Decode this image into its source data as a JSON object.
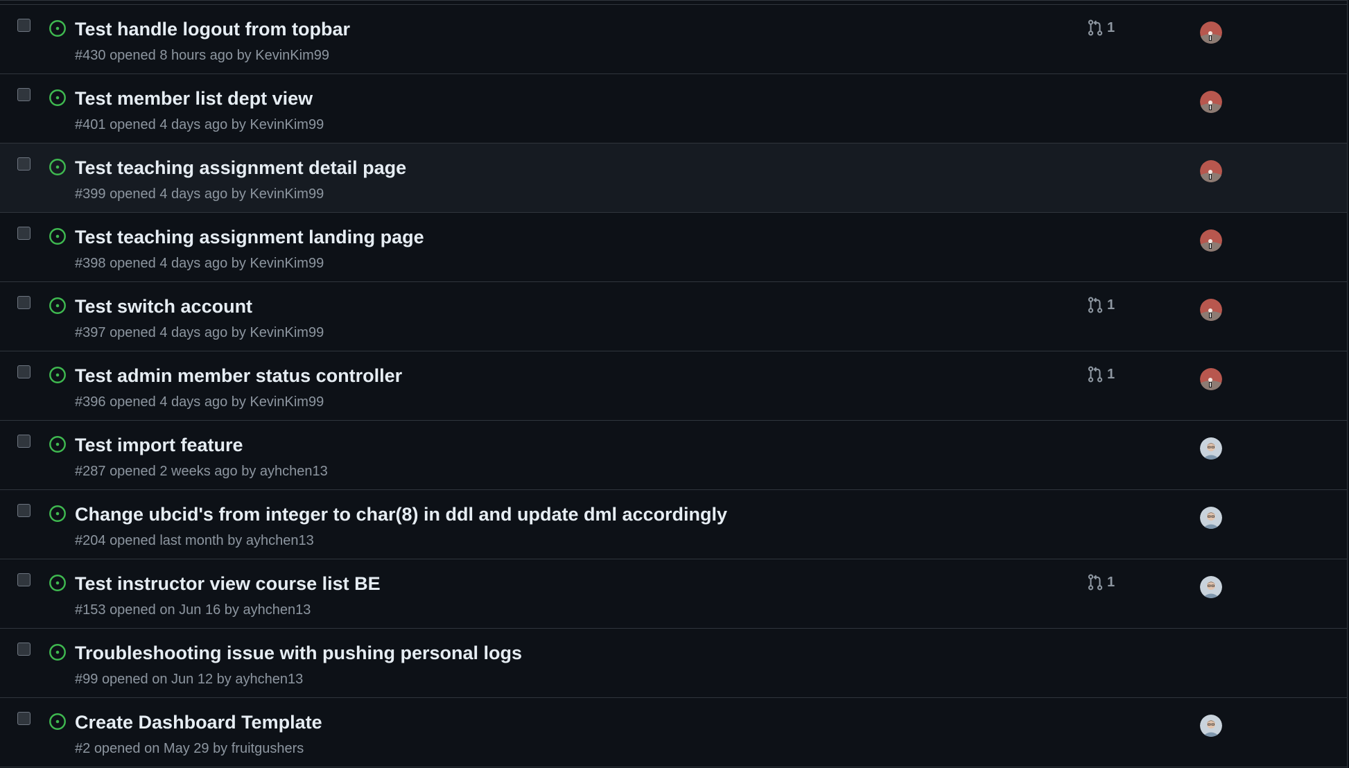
{
  "colors": {
    "background": "#0d1117",
    "row_hover": "#161b22",
    "border": "#30363d",
    "open_icon": "#3fb950",
    "title_text": "#e6edf3",
    "meta_text": "#8d96a0"
  },
  "issues": [
    {
      "title": "Test handle logout from topbar",
      "number": "#430",
      "opened": "opened 8 hours ago",
      "by": "by",
      "author": "KevinKim99",
      "pr_count": "1",
      "avatar": "kevin"
    },
    {
      "title": "Test member list dept view",
      "number": "#401",
      "opened": "opened 4 days ago",
      "by": "by",
      "author": "KevinKim99",
      "pr_count": null,
      "avatar": "kevin"
    },
    {
      "title": "Test teaching assignment detail page",
      "number": "#399",
      "opened": "opened 4 days ago",
      "by": "by",
      "author": "KevinKim99",
      "pr_count": null,
      "avatar": "kevin"
    },
    {
      "title": "Test teaching assignment landing page",
      "number": "#398",
      "opened": "opened 4 days ago",
      "by": "by",
      "author": "KevinKim99",
      "pr_count": null,
      "avatar": "kevin"
    },
    {
      "title": "Test switch account",
      "number": "#397",
      "opened": "opened 4 days ago",
      "by": "by",
      "author": "KevinKim99",
      "pr_count": "1",
      "avatar": "kevin"
    },
    {
      "title": "Test admin member status controller",
      "number": "#396",
      "opened": "opened 4 days ago",
      "by": "by",
      "author": "KevinKim99",
      "pr_count": "1",
      "avatar": "kevin"
    },
    {
      "title": "Test import feature",
      "number": "#287",
      "opened": "opened 2 weeks ago",
      "by": "by",
      "author": "ayhchen13",
      "pr_count": null,
      "avatar": "ayh"
    },
    {
      "title": "Change ubcid's from integer to char(8) in ddl and update dml accordingly",
      "number": "#204",
      "opened": "opened last month",
      "by": "by",
      "author": "ayhchen13",
      "pr_count": null,
      "avatar": "ayh"
    },
    {
      "title": "Test instructor view course list BE",
      "number": "#153",
      "opened": "opened on Jun 16",
      "by": "by",
      "author": "ayhchen13",
      "pr_count": "1",
      "avatar": "ayh"
    },
    {
      "title": "Troubleshooting issue with pushing personal logs",
      "number": "#99",
      "opened": "opened on Jun 12",
      "by": "by",
      "author": "ayhchen13",
      "pr_count": null,
      "avatar": null
    },
    {
      "title": "Create Dashboard Template",
      "number": "#2",
      "opened": "opened on May 29",
      "by": "by",
      "author": "fruitgushers",
      "pr_count": null,
      "avatar": "ayh"
    }
  ]
}
